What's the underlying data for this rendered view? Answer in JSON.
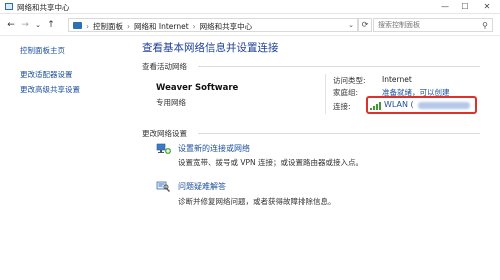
{
  "window": {
    "title": "网络和共享中心",
    "minimize_glyph": "—",
    "maximize_glyph": "☐",
    "close_glyph": "✕"
  },
  "nav": {
    "back_glyph": "←",
    "forward_glyph": "→",
    "recent_glyph": "⌄",
    "up_glyph": "↑",
    "refresh_glyph": "⟳",
    "dropdown_glyph": "⌄"
  },
  "breadcrumb": {
    "separator": "›",
    "items": [
      "控制面板",
      "网络和 Internet",
      "网络和共享中心"
    ]
  },
  "search": {
    "placeholder": "搜索控制面板",
    "icon": "search-icon",
    "icon_glyph": "⚲"
  },
  "sidebar": {
    "items": [
      "控制面板主页",
      "更改适配器设置",
      "更改高级共享设置"
    ]
  },
  "main": {
    "title": "查看基本网络信息并设置连接",
    "active_networks_label": "查看活动网络",
    "network": {
      "name": "Weaver Software",
      "category": "专用网络",
      "access_type_label": "访问类型:",
      "access_type_value": "Internet",
      "homegroup_label": "家庭组:",
      "homegroup_value": "准备就绪，可以创建",
      "connection_label": "连接:",
      "connection_value": "WLAN (",
      "connection_icon": "wifi-signal-icon",
      "highlight_color": "#e0302a"
    },
    "change_settings_label": "更改网络设置",
    "tasks": [
      {
        "icon": "network-setup-icon",
        "link": "设置新的连接或网络",
        "description": "设置宽带、拨号或 VPN 连接；或设置路由器或接入点。"
      },
      {
        "icon": "troubleshoot-icon",
        "link": "问题疑难解答",
        "description": "诊断并修复网络问题，或者获得故障排除信息。"
      }
    ]
  },
  "colors": {
    "link": "#1c4f9c",
    "title": "#1e3f9a",
    "signal": "#3f9b2f"
  }
}
